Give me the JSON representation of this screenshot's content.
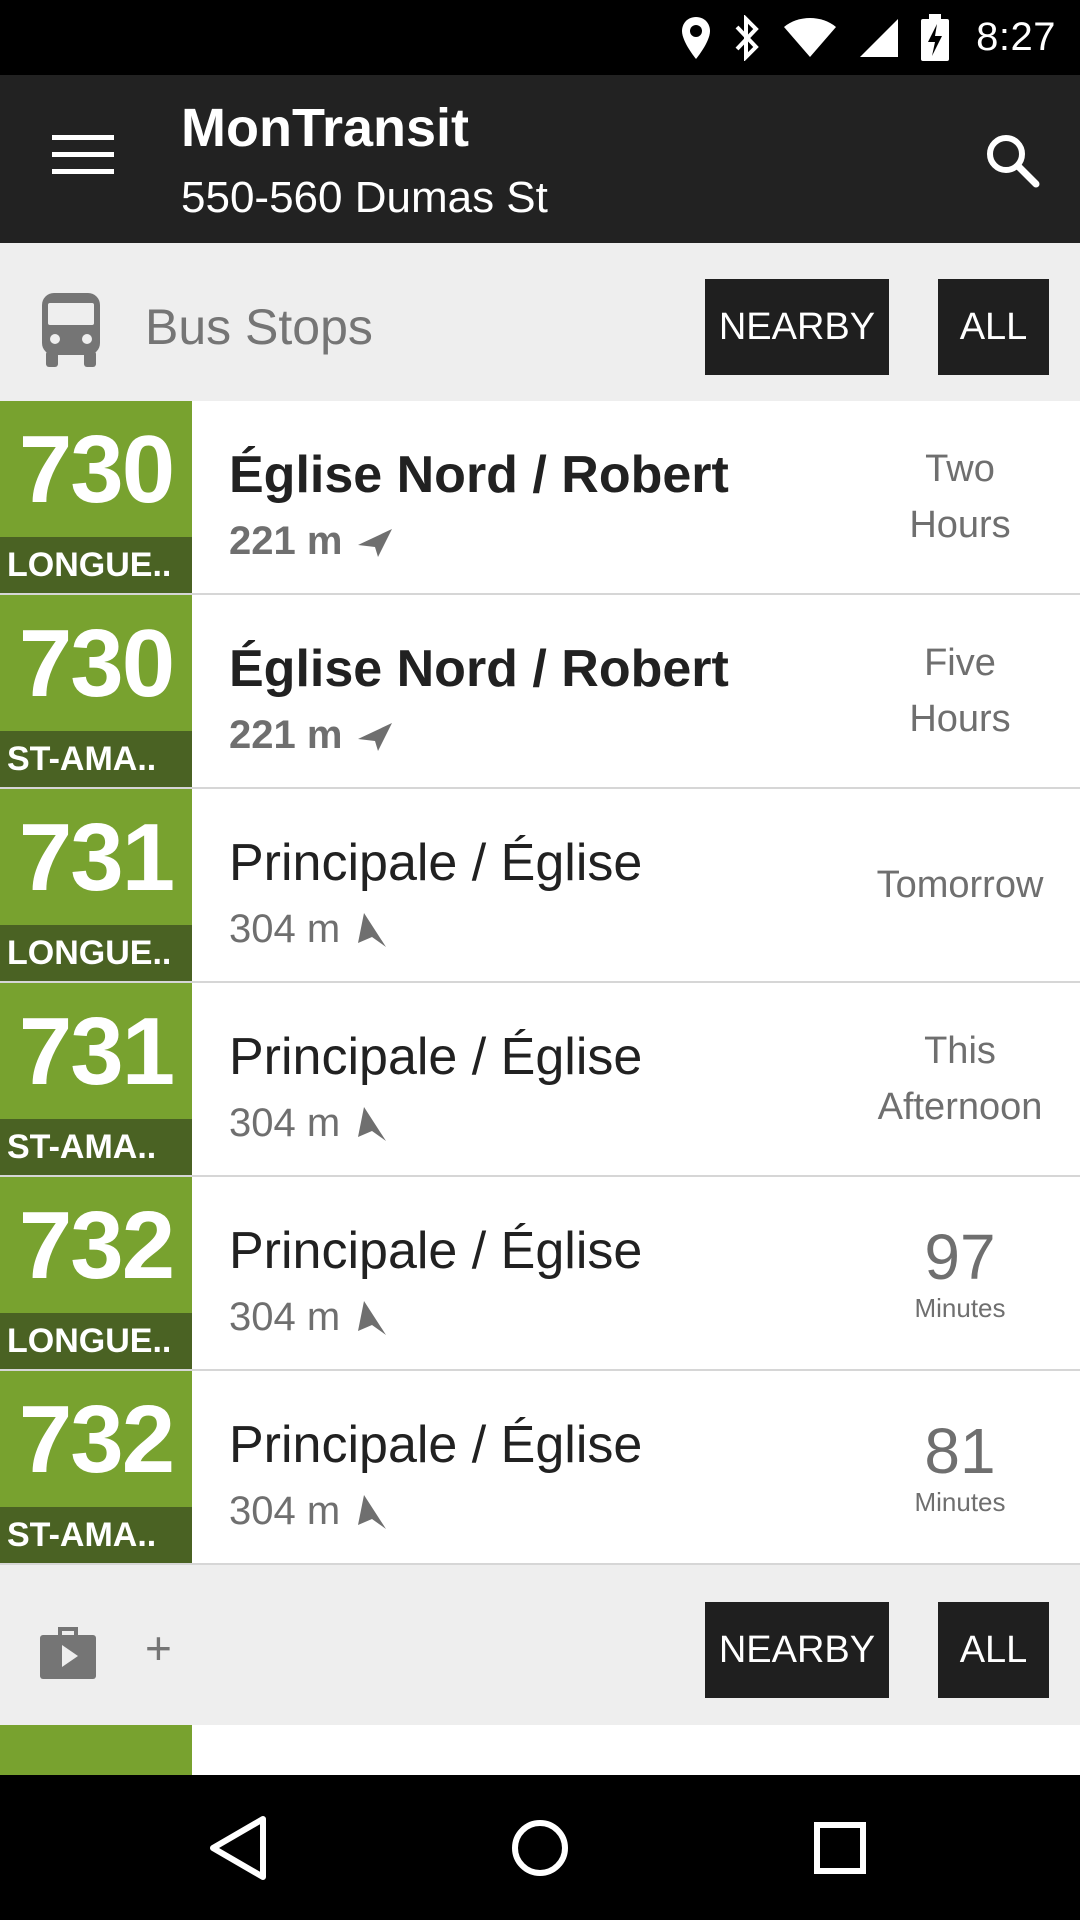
{
  "status_bar": {
    "time": "8:27"
  },
  "toolbar": {
    "title": "MonTransit",
    "subtitle": "550-560 Dumas St"
  },
  "section_bus": {
    "title": "Bus Stops",
    "nearby_label": "NEARBY",
    "all_label": "ALL"
  },
  "stops": [
    {
      "route": "730",
      "direction": "LONGUE..",
      "name": "Église Nord / Robert",
      "distance": "221 m",
      "time_line1": "Two",
      "time_line2": "Hours"
    },
    {
      "route": "730",
      "direction": "ST-AMA..",
      "name": "Église Nord / Robert",
      "distance": "221 m",
      "time_line1": "Five",
      "time_line2": "Hours"
    },
    {
      "route": "731",
      "direction": "LONGUE..",
      "name": "Principale / Église",
      "distance": "304 m",
      "time_line1": "Tomorrow"
    },
    {
      "route": "731",
      "direction": "ST-AMA..",
      "name": "Principale / Église",
      "distance": "304 m",
      "time_line1": "This",
      "time_line2": "Afternoon"
    },
    {
      "route": "732",
      "direction": "LONGUE..",
      "name": "Principale / Église",
      "distance": "304 m",
      "time_value": "97",
      "time_unit": "Minutes"
    },
    {
      "route": "732",
      "direction": "ST-AMA..",
      "name": "Principale / Église",
      "distance": "304 m",
      "time_value": "81",
      "time_unit": "Minutes"
    }
  ],
  "section_more": {
    "title": "+",
    "nearby_label": "NEARBY",
    "all_label": "ALL"
  },
  "colors": {
    "route_green": "#78a22f",
    "route_dark_green": "#4a6223",
    "toolbar": "#222222"
  }
}
